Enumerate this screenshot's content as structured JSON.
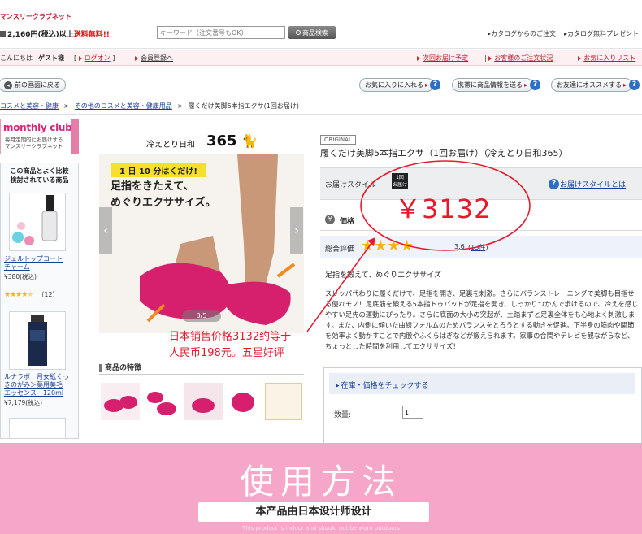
{
  "header": {
    "site_name": "マンスリークラブネット",
    "free_shipping_prefix": "2,160円(税込)以上",
    "free_shipping_suffix": "送料無料!!",
    "search_placeholder": "キーワード（注文番号もOK）",
    "search_button": "商品検索",
    "catalog_order": "カタログからのご注文",
    "catalog_present": "カタログ無料プレゼント"
  },
  "userbar": {
    "greeting": "こんにちは",
    "guest": "ゲスト様",
    "login": "ログオン",
    "register": "会員登録へ",
    "next_delivery": "次回お届け予定",
    "order_status": "お客様のご注文状況",
    "favorites_list": "お気に入りリスト"
  },
  "actions": {
    "back": "前の画面に戻る",
    "add_favorite": "お気に入りに入れる",
    "send_mobile": "携帯に商品情報を送る",
    "recommend_friend": "お友達にオススメする"
  },
  "breadcrumb": {
    "item1": "コスメと美容・健康",
    "item2": "その他のコスメと美容・健康用品",
    "current": "履くだけ美脚5本指エクサ(1回お届け)"
  },
  "sidebar": {
    "club_logo": "monthly club",
    "club_desc_line1": "毎月定期的にお届けする",
    "club_desc_line2": "マンスリークラブネット",
    "compare_title_line1": "この商品とよく比較",
    "compare_title_line2": "検討されている商品",
    "product1_name_line1": "ジェルトップコート",
    "product1_name_line2": "チャーム",
    "product1_price": "¥380(税込)",
    "product1_rating": 4.5,
    "product1_reviews": "（12）",
    "product2_name_line1": "ルナラボ　月女紙くっ",
    "product2_name_line2": "きのがみ＞薬用美毛",
    "product2_name_line3": "エッセンス　120ml",
    "product2_price": "¥7,179(税込)"
  },
  "gallery": {
    "banner_text": "冷えとり日和",
    "banner_number": "365",
    "badge": "1 日 10 分はくだけ!",
    "headline_line1": "足指をきたえて、",
    "headline_line2": "めぐりエクササイズ。",
    "counter": "3/5",
    "prev_icon": "chevron-left-icon",
    "next_icon": "chevron-right-icon",
    "features_title": "商品の特徴"
  },
  "product": {
    "original_tag": "ORIGINAL",
    "title": "履くだけ美脚5本指エクサ（1回お届け）（冷えとり日和365）",
    "delivery_style_label": "お届けスタイル",
    "delivery_badge_line1": "1回",
    "delivery_badge_line2": "お届け",
    "delivery_style_link": "お届けスタイルとは",
    "price_label": "価格",
    "rating_label": "総合評価",
    "rating": 3.6,
    "rating_text": "3.6",
    "review_count": "13件",
    "tagline": "足指を鍛えて、めぐりエクササイズ",
    "description": "スリッパ代わりに履くだけで、足指を開き、足裏を刺激。さらにバランストレーニングで美脚も目指せる優れモノ！足底筋を鍛える5本指トゥパッドが足指を開き、しっかりつかんで歩けるので、冷えを感じやすい足先の運動にぴったり。さらに底面の大小の突起が、土踏まずと足裏全体をも心地よく刺激します。また、内側に傾いた曲線フォルムのためバランスをとろうとする動きを促進。下半身の筋肉や関節を効率よく動かすことで内股やふくらはぎなどが鍛えられます。家事の合間やテレビを観ながらなど、ちょっとした時間を利用してエクササイズ！",
    "check_stock": "在庫・価格をチェックする",
    "quantity_label": "数量:",
    "quantity_value": "1"
  },
  "annotation": {
    "price_overlay": "￥3132",
    "note_line1": "日本销售价格3132约等于",
    "note_line2": "人民币198元。五星好评"
  },
  "footer_banner": {
    "title": "使用方法",
    "subtitle": "本产品由日本设计师设计",
    "english": "This product is indoor and should not be worn outdoors"
  },
  "colors": {
    "accent_red": "#e8192c",
    "link_blue": "#1a3f9a",
    "banner_pink": "#f6a6c8",
    "slipper_pink": "#d61f6d",
    "star_yellow": "#f5b400"
  }
}
